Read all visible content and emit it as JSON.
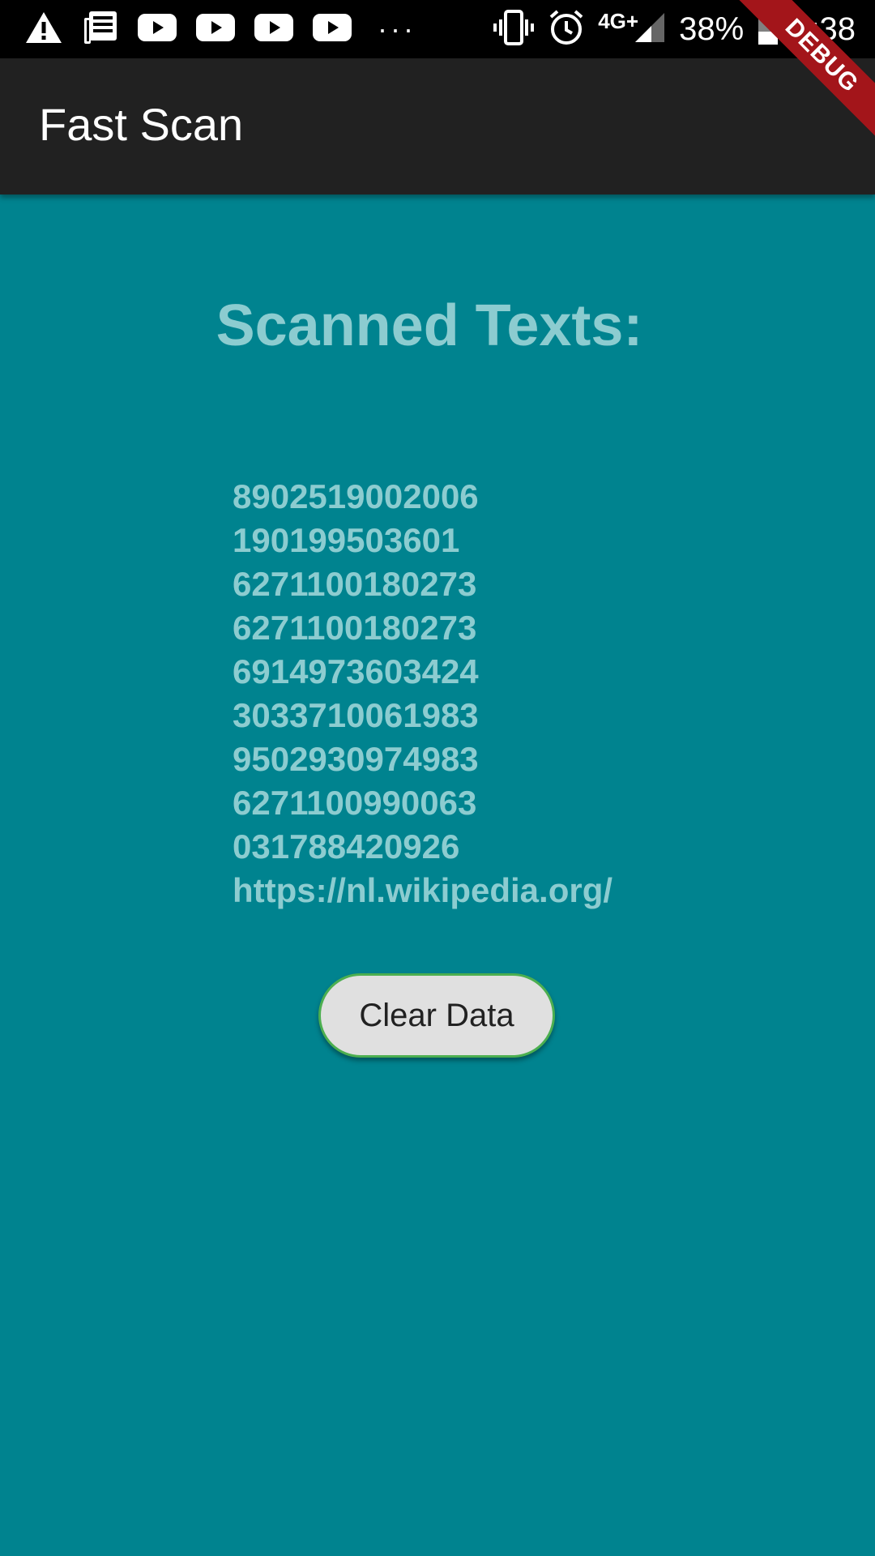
{
  "status_bar": {
    "left_icons": [
      "warning-icon",
      "news-icon",
      "youtube-icon",
      "youtube-icon",
      "youtube-icon",
      "youtube-icon",
      "more-dots-icon"
    ],
    "network_type": "4G+",
    "battery_percent": "38%",
    "time": "9:38"
  },
  "debug_banner": {
    "label": "DEBUG",
    "color": "#a3151a"
  },
  "app_bar": {
    "title": "Fast Scan",
    "background": "#212121"
  },
  "content": {
    "background": "#00838f",
    "text_color": "#8cccd0",
    "heading": "Scanned Texts:",
    "scanned_items": [
      "8902519002006",
      "190199503601",
      "6271100180273",
      "6271100180273",
      "6914973603424",
      "3033710061983",
      "9502930974983",
      "6271100990063",
      "031788420926",
      "https://nl.wikipedia.org/"
    ],
    "clear_button_label": "Clear Data",
    "clear_button_border": "#4caf50"
  }
}
